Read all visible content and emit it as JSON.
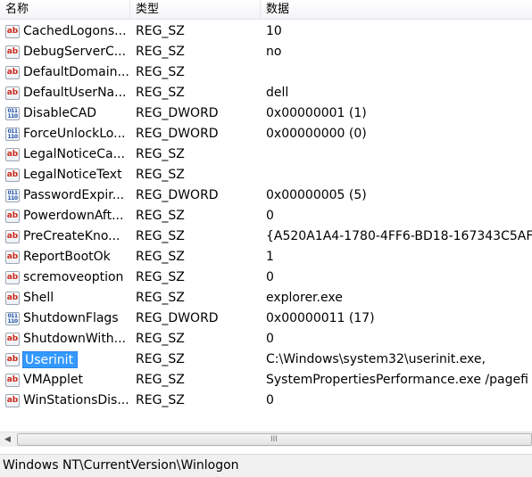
{
  "columns": {
    "name": "名称",
    "type": "类型",
    "data": "数据"
  },
  "rows": [
    {
      "icon": "ab",
      "name": "CachedLogons...",
      "type": "REG_SZ",
      "data": "10"
    },
    {
      "icon": "ab",
      "name": "DebugServerC...",
      "type": "REG_SZ",
      "data": "no"
    },
    {
      "icon": "ab",
      "name": "DefaultDomain...",
      "type": "REG_SZ",
      "data": ""
    },
    {
      "icon": "ab",
      "name": "DefaultUserNa...",
      "type": "REG_SZ",
      "data": "dell"
    },
    {
      "icon": "dw",
      "name": "DisableCAD",
      "type": "REG_DWORD",
      "data": "0x00000001 (1)"
    },
    {
      "icon": "dw",
      "name": "ForceUnlockLo...",
      "type": "REG_DWORD",
      "data": "0x00000000 (0)"
    },
    {
      "icon": "ab",
      "name": "LegalNoticeCa...",
      "type": "REG_SZ",
      "data": ""
    },
    {
      "icon": "ab",
      "name": "LegalNoticeText",
      "type": "REG_SZ",
      "data": ""
    },
    {
      "icon": "dw",
      "name": "PasswordExpir...",
      "type": "REG_DWORD",
      "data": "0x00000005 (5)"
    },
    {
      "icon": "ab",
      "name": "PowerdownAft...",
      "type": "REG_SZ",
      "data": "0"
    },
    {
      "icon": "ab",
      "name": "PreCreateKno...",
      "type": "REG_SZ",
      "data": "{A520A1A4-1780-4FF6-BD18-167343C5AF"
    },
    {
      "icon": "ab",
      "name": "ReportBootOk",
      "type": "REG_SZ",
      "data": "1"
    },
    {
      "icon": "ab",
      "name": "scremoveoption",
      "type": "REG_SZ",
      "data": "0"
    },
    {
      "icon": "ab",
      "name": "Shell",
      "type": "REG_SZ",
      "data": "explorer.exe"
    },
    {
      "icon": "dw",
      "name": "ShutdownFlags",
      "type": "REG_DWORD",
      "data": "0x00000011 (17)"
    },
    {
      "icon": "ab",
      "name": "ShutdownWith...",
      "type": "REG_SZ",
      "data": "0"
    },
    {
      "icon": "ab",
      "name": "Userinit",
      "type": "REG_SZ",
      "data": "C:\\Windows\\system32\\userinit.exe,",
      "selected": true
    },
    {
      "icon": "ab",
      "name": "VMApplet",
      "type": "REG_SZ",
      "data": "SystemPropertiesPerformance.exe /pagefi"
    },
    {
      "icon": "ab",
      "name": "WinStationsDis...",
      "type": "REG_SZ",
      "data": "0"
    }
  ],
  "icons": {
    "ab": "string-value-icon",
    "dw": "dword-value-icon"
  },
  "icon_glyphs": {
    "ab": "ab",
    "dw": "011 110"
  },
  "scrollbar": {
    "left_arrow": "◀",
    "grip": "III"
  },
  "status": {
    "path": "Windows NT\\CurrentVersion\\Winlogon"
  },
  "colors": {
    "selection": "#3399ff",
    "string_icon": "#c8261a",
    "dword_icon": "#1c4fa8"
  }
}
